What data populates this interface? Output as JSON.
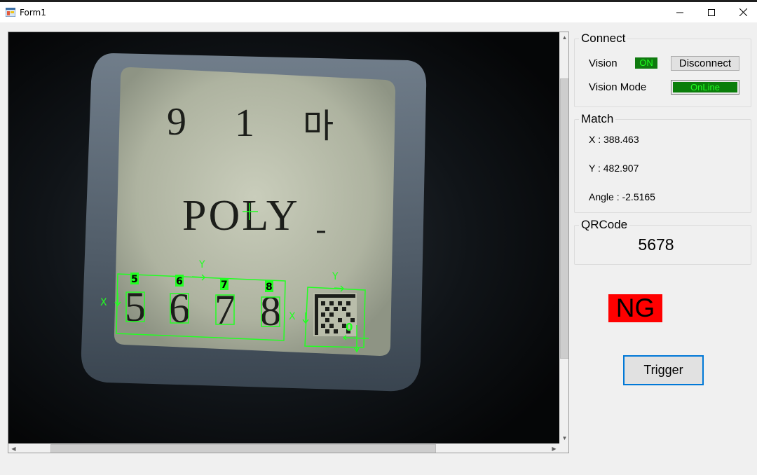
{
  "window": {
    "title": "Form1",
    "controls": [
      "minimize-icon",
      "maximize-icon",
      "close-icon"
    ]
  },
  "viewer": {
    "card_text": {
      "line1": [
        "9",
        "1",
        "마"
      ],
      "line2": "POLY",
      "digits": [
        "5",
        "6",
        "7",
        "8"
      ]
    },
    "overlay": {
      "color": "#22ff22",
      "digit_labels": [
        "5",
        "6",
        "7",
        "8"
      ],
      "axis_x": "X",
      "axis_y": "Y",
      "qr_index": "0"
    },
    "vscroll_position": 0.11,
    "hscroll_position": 0.08
  },
  "connect": {
    "title": "Connect",
    "vision_label": "Vision",
    "vision_status": "ON",
    "disconnect_label": "Disconnect",
    "mode_label": "Vision Mode",
    "mode_value": "OnLine"
  },
  "match": {
    "title": "Match",
    "x_text": "X : 388.463",
    "y_text": "Y : 482.907",
    "angle_text": "Angle : -2.5165"
  },
  "qrcode": {
    "title": "QRCode",
    "value": "5678"
  },
  "result": {
    "text": "NG",
    "color": "#ff0000"
  },
  "trigger": {
    "label": "Trigger"
  }
}
